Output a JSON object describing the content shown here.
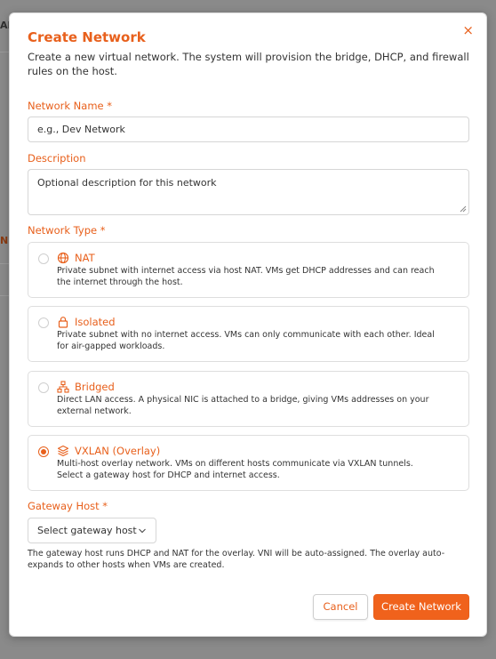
{
  "background": {
    "fragments": [
      "Al",
      "N"
    ]
  },
  "modal": {
    "title": "Create Network",
    "close_glyph": "×",
    "subtitle": "Create a new virtual network. The system will provision the bridge, DHCP, and firewall rules on the host."
  },
  "form": {
    "name_label": "Network Name *",
    "name_placeholder": "e.g., Dev Network",
    "description_label": "Description",
    "description_placeholder": "Optional description for this network",
    "type_label": "Network Type *",
    "gateway_label": "Gateway Host *",
    "gateway_value": "Select gateway host",
    "gateway_help": "The gateway host runs DHCP and NAT for the overlay. VNI will be auto-assigned. The overlay auto-expands to other hosts when VMs are created."
  },
  "network_types": [
    {
      "title": "NAT",
      "icon": "globe-icon",
      "selected": false,
      "description": "Private subnet with internet access via host NAT. VMs get DHCP addresses and can reach the internet through the host."
    },
    {
      "title": "Isolated",
      "icon": "lock-icon",
      "selected": false,
      "description": "Private subnet with no internet access. VMs can only communicate with each other. Ideal for air-gapped workloads."
    },
    {
      "title": "Bridged",
      "icon": "network-tree-icon",
      "selected": false,
      "description": "Direct LAN access. A physical NIC is attached to a bridge, giving VMs addresses on your external network."
    },
    {
      "title": "VXLAN (Overlay)",
      "icon": "layers-icon",
      "selected": true,
      "description": "Multi-host overlay network. VMs on different hosts communicate via VXLAN tunnels. Select a gateway host for DHCP and internet access."
    }
  ],
  "buttons": {
    "cancel": "Cancel",
    "create": "Create Network"
  },
  "colors": {
    "accent": "#e8601c",
    "primary_button": "#f0621c"
  }
}
